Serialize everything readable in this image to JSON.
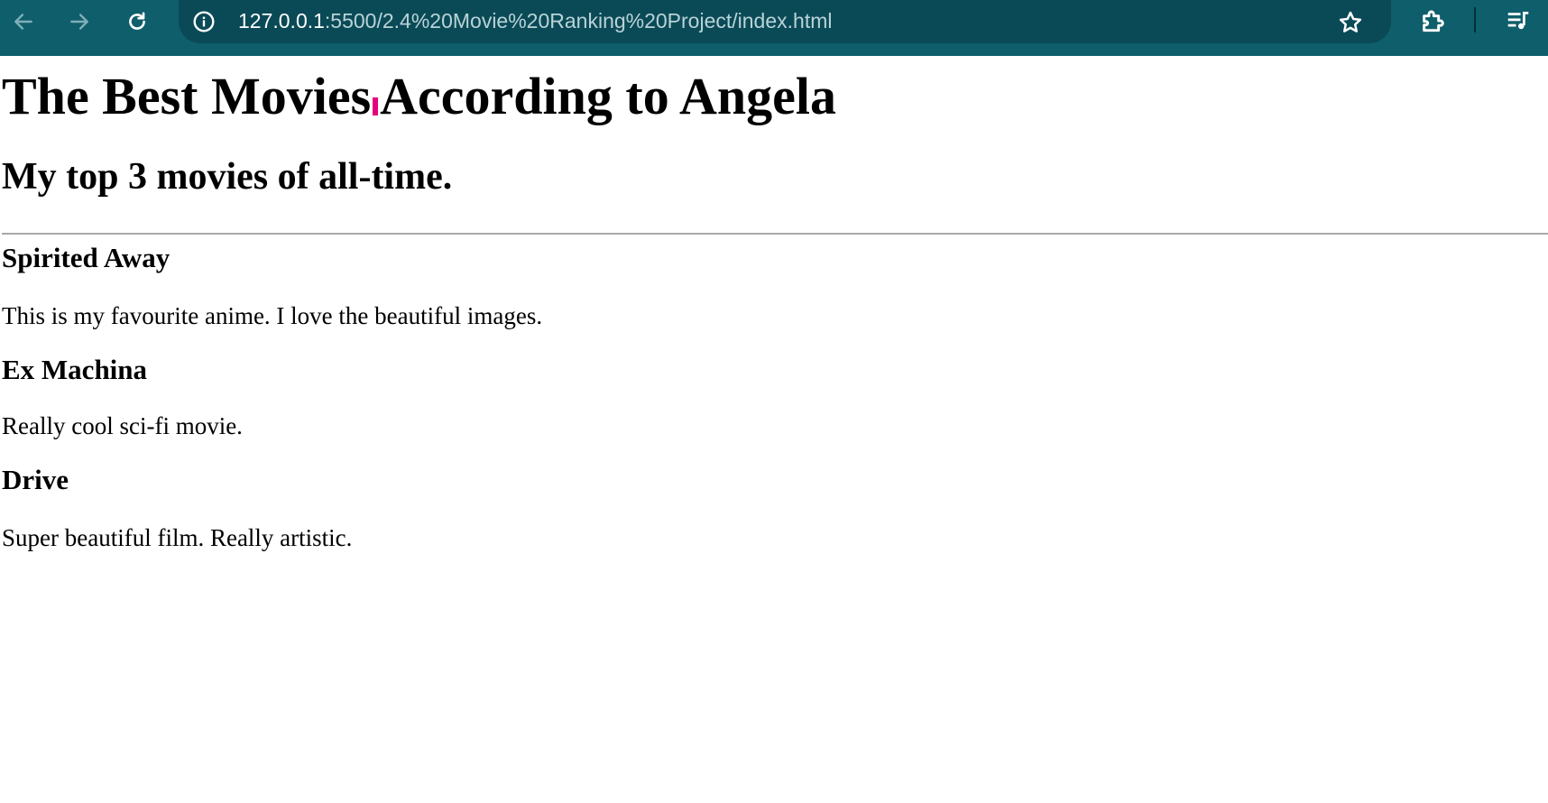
{
  "browser": {
    "url_host": "127.0.0.1",
    "url_path": ":5500/2.4%20Movie%20Ranking%20Project/index.html",
    "colors": {
      "toolbar": "#0f5e6b",
      "omnibox": "#0a4a56",
      "icon_active": "#ffffff",
      "icon_disabled": "#7fb0b8"
    },
    "icons": {
      "back": "arrow-left",
      "forward": "arrow-right",
      "reload": "circular-arrow",
      "site_info": "info-circle",
      "bookmark": "star-outline",
      "extensions": "puzzle-piece",
      "media": "media-queue"
    }
  },
  "page": {
    "title": "The Best Movies According to Angela",
    "title_part1": "The Best Movies",
    "title_part2": "According to Angela",
    "subtitle": "My top 3 movies of all-time.",
    "movies": [
      {
        "name": "Spirited Away",
        "description": "This is my favourite anime. I love the beautiful images."
      },
      {
        "name": "Ex Machina",
        "description": "Really cool sci-fi movie."
      },
      {
        "name": "Drive",
        "description": "Super beautiful film. Really artistic."
      }
    ],
    "cursor_color": "#e6007e"
  }
}
